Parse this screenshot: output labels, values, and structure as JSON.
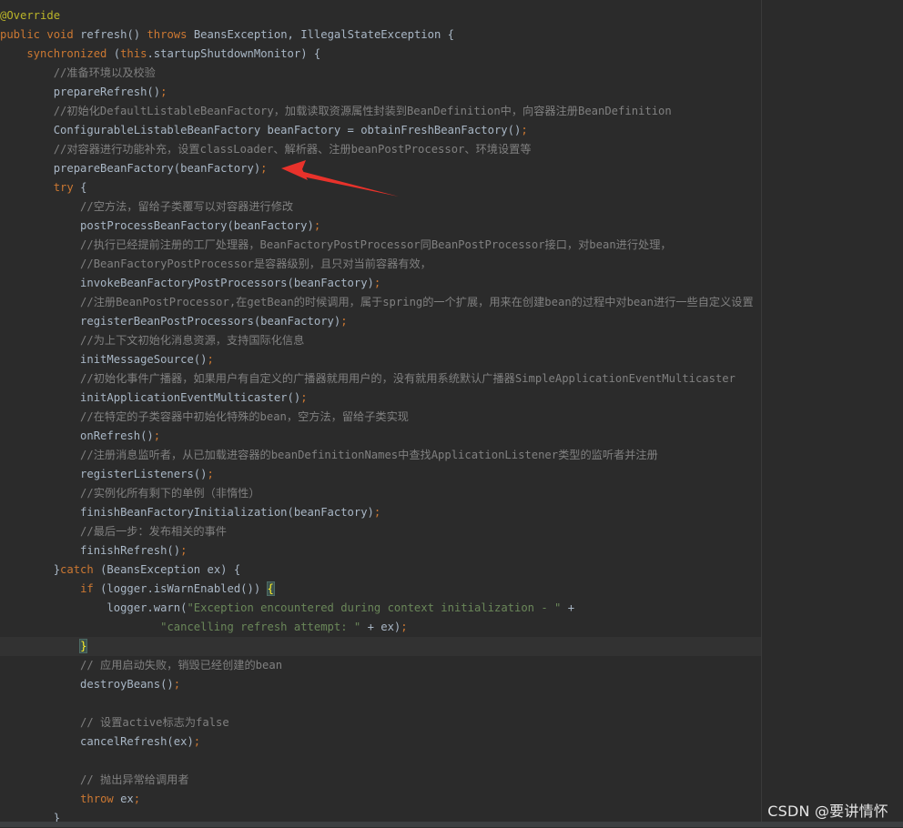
{
  "watermark": "CSDN @要讲情怀",
  "annotation": {
    "arrow_color": "#e8322b",
    "shape": "red arrow pointing at prepareBeanFactory line"
  },
  "theme": {
    "background": "#2b2b2b",
    "keyword": "#cc7832",
    "comment": "#808080",
    "string": "#6a8759",
    "annotation": "#bbb529",
    "text": "#a9b7c6"
  },
  "code": {
    "l01": "@Override",
    "l02a": "public void ",
    "l02b": "refresh",
    "l02c": "() ",
    "l02d": "throws ",
    "l02e": "BeansException, IllegalStateException {",
    "l03a": "    synchronized ",
    "l03b": "(",
    "l03c": "this",
    "l03d": ".startupShutdownMonitor) {",
    "l04": "        //准备环境以及校验",
    "l05a": "        prepareRefresh()",
    "l05b": ";",
    "l06": "        //初始化DefaultListableBeanFactory，加载读取资源属性封装到BeanDefinition中，向容器注册BeanDefinition",
    "l07a": "        ConfigurableListableBeanFactory beanFactory = obtainFreshBeanFactory()",
    "l07b": ";",
    "l08": "        //对容器进行功能补充，设置classLoader、解析器、注册beanPostProcessor、环境设置等",
    "l09a": "        prepareBeanFactory(beanFactory)",
    "l09b": ";",
    "l10a": "        try ",
    "l10b": "{",
    "l11": "            //空方法，留给子类覆写以对容器进行修改",
    "l12a": "            postProcessBeanFactory(beanFactory)",
    "l12b": ";",
    "l13": "            //执行已经提前注册的工厂处理器，BeanFactoryPostProcessor同BeanPostProcessor接口，对bean进行处理，",
    "l14": "            //BeanFactoryPostProcessor是容器级别，且只对当前容器有效，",
    "l15a": "            invokeBeanFactoryPostProcessors(beanFactory)",
    "l15b": ";",
    "l16": "            //注册BeanPostProcessor,在getBean的时候调用，属于spring的一个扩展，用来在创建bean的过程中对bean进行一些自定义设置",
    "l17a": "            registerBeanPostProcessors(beanFactory)",
    "l17b": ";",
    "l18": "            //为上下文初始化消息资源，支持国际化信息",
    "l19a": "            initMessageSource()",
    "l19b": ";",
    "l20": "            //初始化事件广播器，如果用户有自定义的广播器就用用户的，没有就用系统默认广播器SimpleApplicationEventMulticaster",
    "l21a": "            initApplicationEventMulticaster()",
    "l21b": ";",
    "l22": "            //在特定的子类容器中初始化特殊的bean，空方法，留给子类实现",
    "l23a": "            onRefresh()",
    "l23b": ";",
    "l24": "            //注册消息监听者，从已加载进容器的beanDefinitionNames中查找ApplicationListener类型的监听者并注册",
    "l25a": "            registerListeners()",
    "l25b": ";",
    "l26": "            //实例化所有剩下的单例（非惰性）",
    "l27a": "            finishBeanFactoryInitialization(beanFactory)",
    "l27b": ";",
    "l28": "            //最后一步：发布相关的事件",
    "l29a": "            finishRefresh()",
    "l29b": ";",
    "l30a": "        }",
    "l30b": "catch ",
    "l30c": "(BeansException ex) {",
    "l31a": "            ",
    "l31b": "if ",
    "l31c": "(logger.isWarnEnabled()) ",
    "l31d": "{",
    "l32a": "                logger.warn(",
    "l32b": "\"Exception encountered during context initialization - \" ",
    "l32c": "+",
    "l33a": "                        ",
    "l33b": "\"cancelling refresh attempt: \" ",
    "l33c": "+ ex)",
    "l33d": ";",
    "l34a": "            ",
    "l34b": "}",
    "l35": "            // 应用启动失败，销毁已经创建的bean",
    "l36a": "            destroyBeans()",
    "l36b": ";",
    "l37": "",
    "l38": "            // 设置active标志为false",
    "l39a": "            cancelRefresh(ex)",
    "l39b": ";",
    "l40": "",
    "l41": "            // 抛出异常给调用者",
    "l42a": "            ",
    "l42b": "throw ",
    "l42c": "ex",
    "l42d": ";",
    "l43": "        }"
  }
}
